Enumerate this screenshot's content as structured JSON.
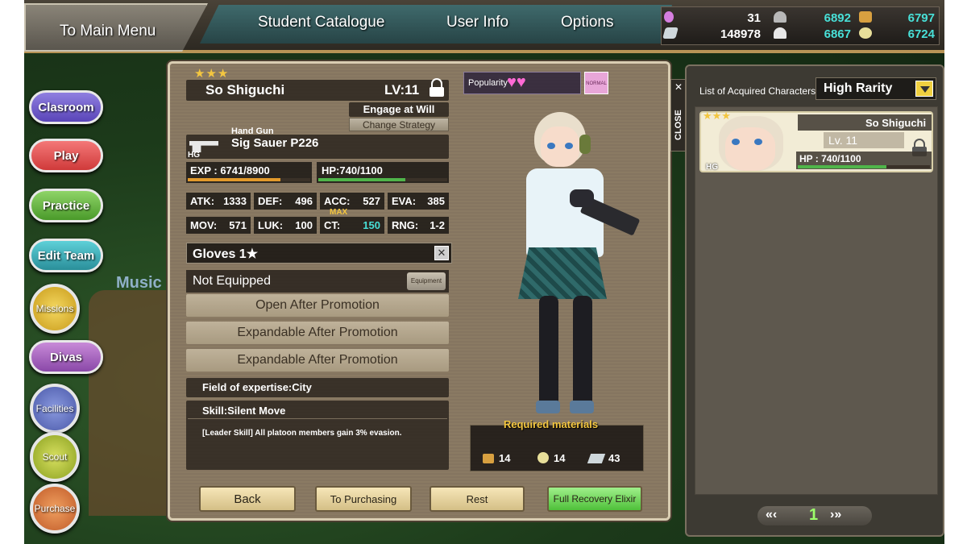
{
  "header": {
    "main_menu": "To Main Menu",
    "tabs": [
      "Student Catalogue",
      "User Info",
      "Options"
    ],
    "resources": {
      "r1": "31",
      "r2": "6892",
      "r3": "6797",
      "r4": "148978",
      "r5": "6867",
      "r6": "6724"
    }
  },
  "left_nav": {
    "classroom": "Clasroom",
    "play": "Play",
    "practice": "Practice",
    "edit_team": "Edit Team",
    "missions": "Missions",
    "divas": "Divas",
    "facilities": "Facilities",
    "scout": "Scout",
    "purchase": "Purchase"
  },
  "background_text": {
    "music": "Music"
  },
  "character": {
    "stars": "★★★",
    "name": "So Shiguchi",
    "level": "LV:11",
    "engage": "Engage at Will",
    "change_strategy": "Change Strategy",
    "weapon_type": "Hand Gun",
    "weapon_badge": "HG",
    "weapon_name": "Sig Sauer P226",
    "exp": "EXP : 6741/8900",
    "exp_fraction": 0.757,
    "hp": "HP:740/1100",
    "hp_fraction": 0.673,
    "stats": {
      "atk_l": "ATK:",
      "atk": "1333",
      "def_l": "DEF:",
      "def": "496",
      "acc_l": "ACC:",
      "acc": "527",
      "eva_l": "EVA:",
      "eva": "385",
      "mov_l": "MOV:",
      "mov": "571",
      "luk_l": "LUK:",
      "luk": "100",
      "ct_l": "CT:",
      "ct": "150",
      "ct_max": "MAX",
      "rng_l": "RNG:",
      "rng": "1-2"
    },
    "popularity_label": "Popularity",
    "popularity_hearts": "♥♥",
    "normal_badge": "NORMAL"
  },
  "equipment": {
    "item": "Gloves 1★",
    "status": "Not Equipped",
    "equip_button": "Equipment",
    "slots": [
      "Open After Promotion",
      "Expandable After Promotion",
      "Expandable After Promotion"
    ]
  },
  "skills": {
    "expertise": "Field of expertise:City",
    "skill": "Skill:Silent Move",
    "leader_skill": "[Leader Skill] All platoon members gain 3% evasion."
  },
  "materials": {
    "title": "Required materials",
    "m1": "14",
    "m2": "14",
    "m3": "43"
  },
  "footer": {
    "back": "Back",
    "purchasing": "To Purchasing",
    "rest": "Rest",
    "elixir": "Full Recovery Elixir"
  },
  "right_panel": {
    "close": "CLOSE",
    "close_x": "✕",
    "list_title": "List of Acquired Characters",
    "filter": "High Rarity",
    "card": {
      "stars": "★★★",
      "name": "So Shiguchi",
      "level": "Lv. 11",
      "hp": "HP : 740/1100",
      "hp_fraction": 0.673,
      "badge": "HG"
    },
    "pager": {
      "page": "1"
    }
  },
  "colors": {
    "accent_gold": "#f3c640",
    "hp_green": "#4fb54a",
    "exp_orange": "#e39a2b"
  }
}
